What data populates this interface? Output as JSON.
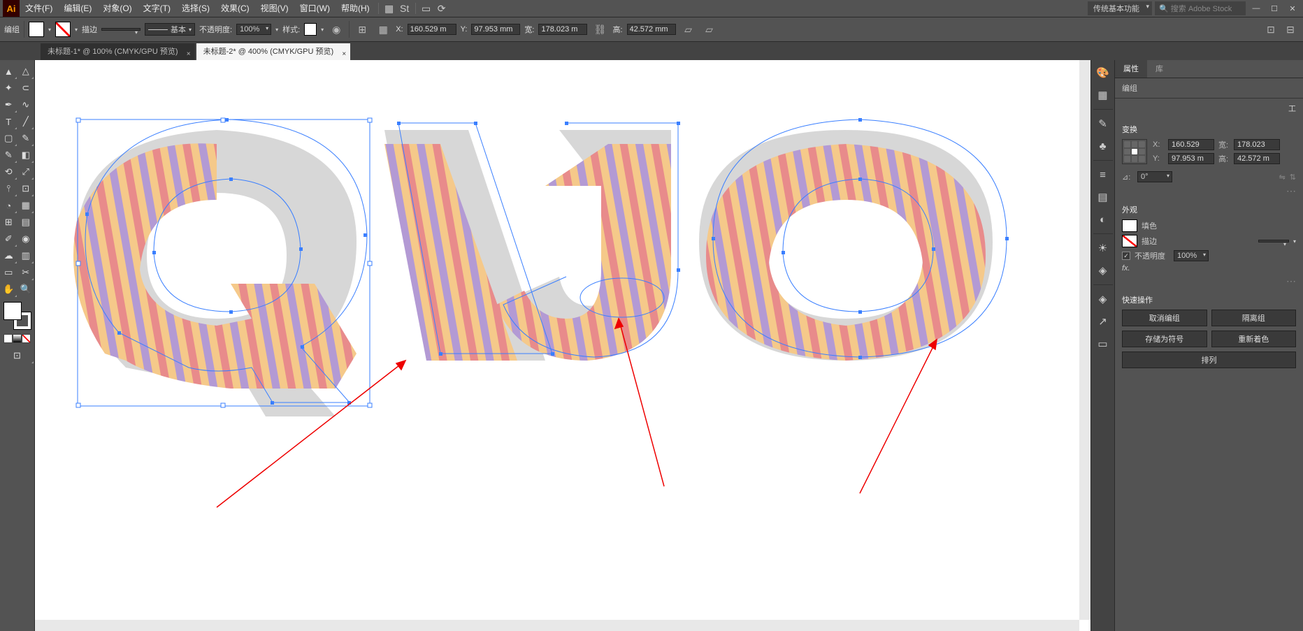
{
  "menubar": {
    "items": [
      "文件(F)",
      "编辑(E)",
      "对象(O)",
      "文字(T)",
      "选择(S)",
      "效果(C)",
      "视图(V)",
      "窗口(W)",
      "帮助(H)"
    ],
    "workspace": "传统基本功能",
    "search_placeholder": "搜索 Adobe Stock"
  },
  "control": {
    "context": "编组",
    "stroke_label": "描边",
    "stroke_weight": "",
    "stroke_style": "基本",
    "opacity_label": "不透明度:",
    "opacity": "100%",
    "style_label": "样式:",
    "x_label": "X:",
    "x": "160.529 m",
    "y_label": "Y:",
    "y": "97.953 mm",
    "w_label": "宽:",
    "w": "178.023 m",
    "h_label": "高:",
    "h": "42.572 mm"
  },
  "tabs": [
    {
      "label": "未标题-1* @ 100% (CMYK/GPU 预览)",
      "active": false
    },
    {
      "label": "未标题-2* @ 400% (CMYK/GPU 预览)",
      "active": true
    }
  ],
  "panel": {
    "tabs": [
      "属性",
      "库"
    ],
    "group_label": "编组",
    "transform": {
      "title": "变换",
      "x_label": "X:",
      "x": "160.529",
      "y_label": "Y:",
      "y": "97.953 m",
      "w_label": "宽:",
      "w": "178.023",
      "h_label": "高:",
      "h": "42.572 m",
      "angle_label": "⊿:",
      "angle": "0°"
    },
    "appearance": {
      "title": "外观",
      "fill_label": "填色",
      "stroke_label": "描边",
      "opacity_label": "不透明度",
      "opacity": "100%",
      "fx": "fx."
    },
    "quick": {
      "title": "快速操作",
      "ungroup": "取消编组",
      "isolate": "隔离组",
      "save_symbol": "存储为符号",
      "recolor": "重新着色",
      "arrange": "排列"
    },
    "edit_toolbar": "工"
  }
}
